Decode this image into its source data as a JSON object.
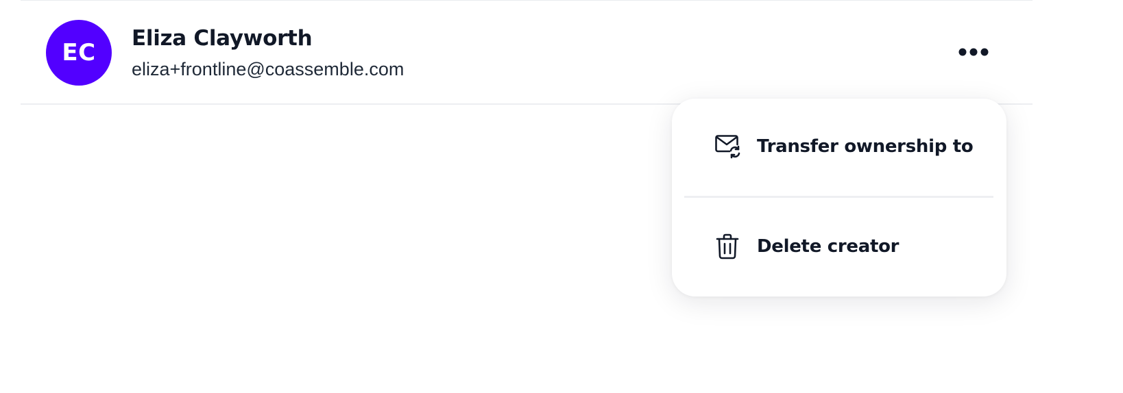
{
  "creator": {
    "initials": "EC",
    "name": "Eliza Clayworth",
    "email": "eliza+frontline@coassemble.com",
    "avatar_color": "#5200ff"
  },
  "more_button": {
    "icon": "more-horizontal-icon"
  },
  "menu": {
    "items": [
      {
        "label": "Transfer ownership to",
        "icon": "mail-transfer-icon"
      },
      {
        "label": "Delete creator",
        "icon": "trash-icon"
      }
    ]
  },
  "colors": {
    "text": "#111827",
    "accent": "#5200ff",
    "divider": "#eceef1"
  }
}
